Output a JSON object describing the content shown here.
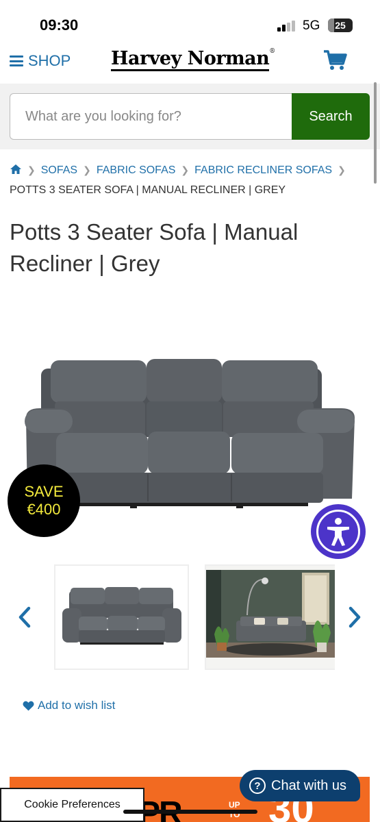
{
  "status_bar": {
    "time": "09:30",
    "network": "5G",
    "battery": "25",
    "battery_level": 0.25
  },
  "header": {
    "menu_label": "SHOP",
    "logo_text": "Harvey Norman",
    "logo_mark": "®"
  },
  "search": {
    "placeholder": "What are you looking for?",
    "value": "",
    "button_label": "Search"
  },
  "breadcrumb": {
    "links": [
      "SOFAS",
      "FABRIC SOFAS",
      "FABRIC RECLINER SOFAS"
    ],
    "current": "POTTS 3 SEATER SOFA | MANUAL RECLINER | GREY"
  },
  "product": {
    "title": "Potts 3 Seater Sofa | Manual Recliner | Grey",
    "badge": {
      "line1": "SAVE",
      "line2": "€400"
    },
    "wishlist_label": "Add to wish list"
  },
  "promo": {
    "text_main": "PR",
    "text_up": "UP",
    "text_to": "TO",
    "text_big": "30"
  },
  "cookie_label": "Cookie Preferences",
  "chat_label": "Chat with us",
  "colors": {
    "link": "#1f6fa8",
    "search_button": "#1f6b0c",
    "badge_text": "#f3ea3c",
    "accessibility": "#4c34c9",
    "chat": "#0d3f6e",
    "promo": "#f26a21"
  }
}
